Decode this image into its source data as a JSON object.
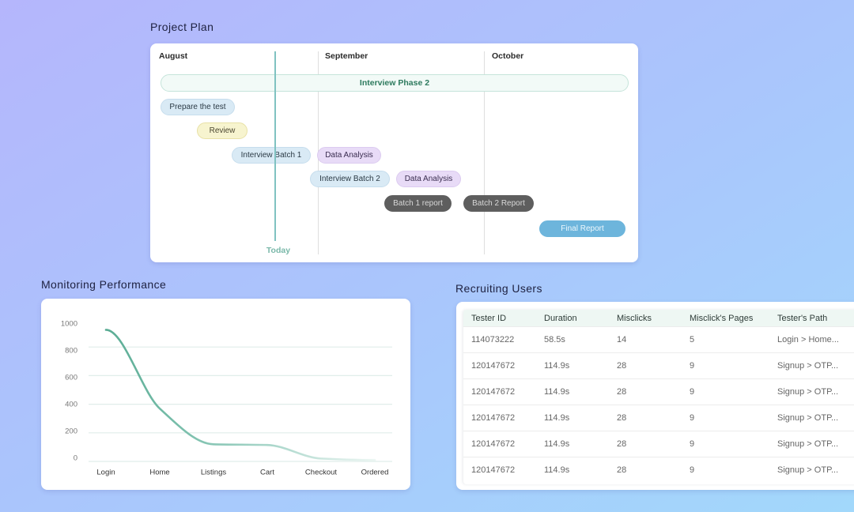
{
  "project_plan": {
    "title": "Project Plan",
    "months": [
      "August",
      "September",
      "October"
    ],
    "today_label": "Today",
    "tasks": [
      {
        "label": "Interview Phase 2",
        "style": "phase"
      },
      {
        "label": "Prepare the test",
        "style": "blue"
      },
      {
        "label": "Review",
        "style": "yellow"
      },
      {
        "label": "Interview Batch 1",
        "style": "blue"
      },
      {
        "label": "Data Analysis",
        "style": "purple"
      },
      {
        "label": "Interview Batch 2",
        "style": "blue"
      },
      {
        "label": "Data Analysis",
        "style": "purple"
      },
      {
        "label": "Batch 1 report",
        "style": "dark"
      },
      {
        "label": "Batch 2 Report",
        "style": "dark"
      },
      {
        "label": "Final Report",
        "style": "final"
      }
    ],
    "styles": {
      "phase": {
        "bg": "#f2faf7",
        "border": "#c5e4da",
        "fg": "#2d7a5e"
      },
      "blue": {
        "bg": "#d9eaf5",
        "border": "#c6dded",
        "fg": "#2b3a45"
      },
      "yellow": {
        "bg": "#f7f4cf",
        "border": "#e8e1a6",
        "fg": "#4b4730"
      },
      "purple": {
        "bg": "#e8dbf7",
        "border": "#dccbf0",
        "fg": "#3a2d50"
      },
      "dark": {
        "bg": "#5e5e5e",
        "border": "#5e5e5e",
        "fg": "#d8d8d8"
      },
      "final": {
        "bg": "#6db5dc",
        "border": "#6db5dc",
        "fg": "#eef8fd"
      }
    },
    "today_color": "#80c2c1"
  },
  "monitoring": {
    "title": "Monitoring Performance",
    "line_color": "#5dae96"
  },
  "recruiting": {
    "title": "Recruiting Users",
    "columns": [
      "Tester ID",
      "Duration",
      "Misclicks",
      "Misclick's Pages",
      "Tester's Path"
    ],
    "rows": [
      [
        "114073222",
        "58.5s",
        "14",
        "5",
        "Login > Home..."
      ],
      [
        "120147672",
        "114.9s",
        "28",
        "9",
        "Signup > OTP..."
      ],
      [
        "120147672",
        "114.9s",
        "28",
        "9",
        "Signup > OTP..."
      ],
      [
        "120147672",
        "114.9s",
        "28",
        "9",
        "Signup > OTP..."
      ],
      [
        "120147672",
        "114.9s",
        "28",
        "9",
        "Signup > OTP..."
      ],
      [
        "120147672",
        "114.9s",
        "28",
        "9",
        "Signup > OTP..."
      ]
    ]
  },
  "chart_data": {
    "type": "line",
    "title": "Monitoring Performance",
    "categories": [
      "Login",
      "Home",
      "Listings",
      "Cart",
      "Checkout",
      "Ordered"
    ],
    "values": [
      920,
      370,
      120,
      115,
      20,
      10
    ],
    "xlabel": "",
    "ylabel": "",
    "ylim": [
      0,
      1000
    ],
    "yticks": [
      0,
      200,
      400,
      600,
      800,
      1000
    ],
    "grid": true,
    "legend": "none"
  }
}
